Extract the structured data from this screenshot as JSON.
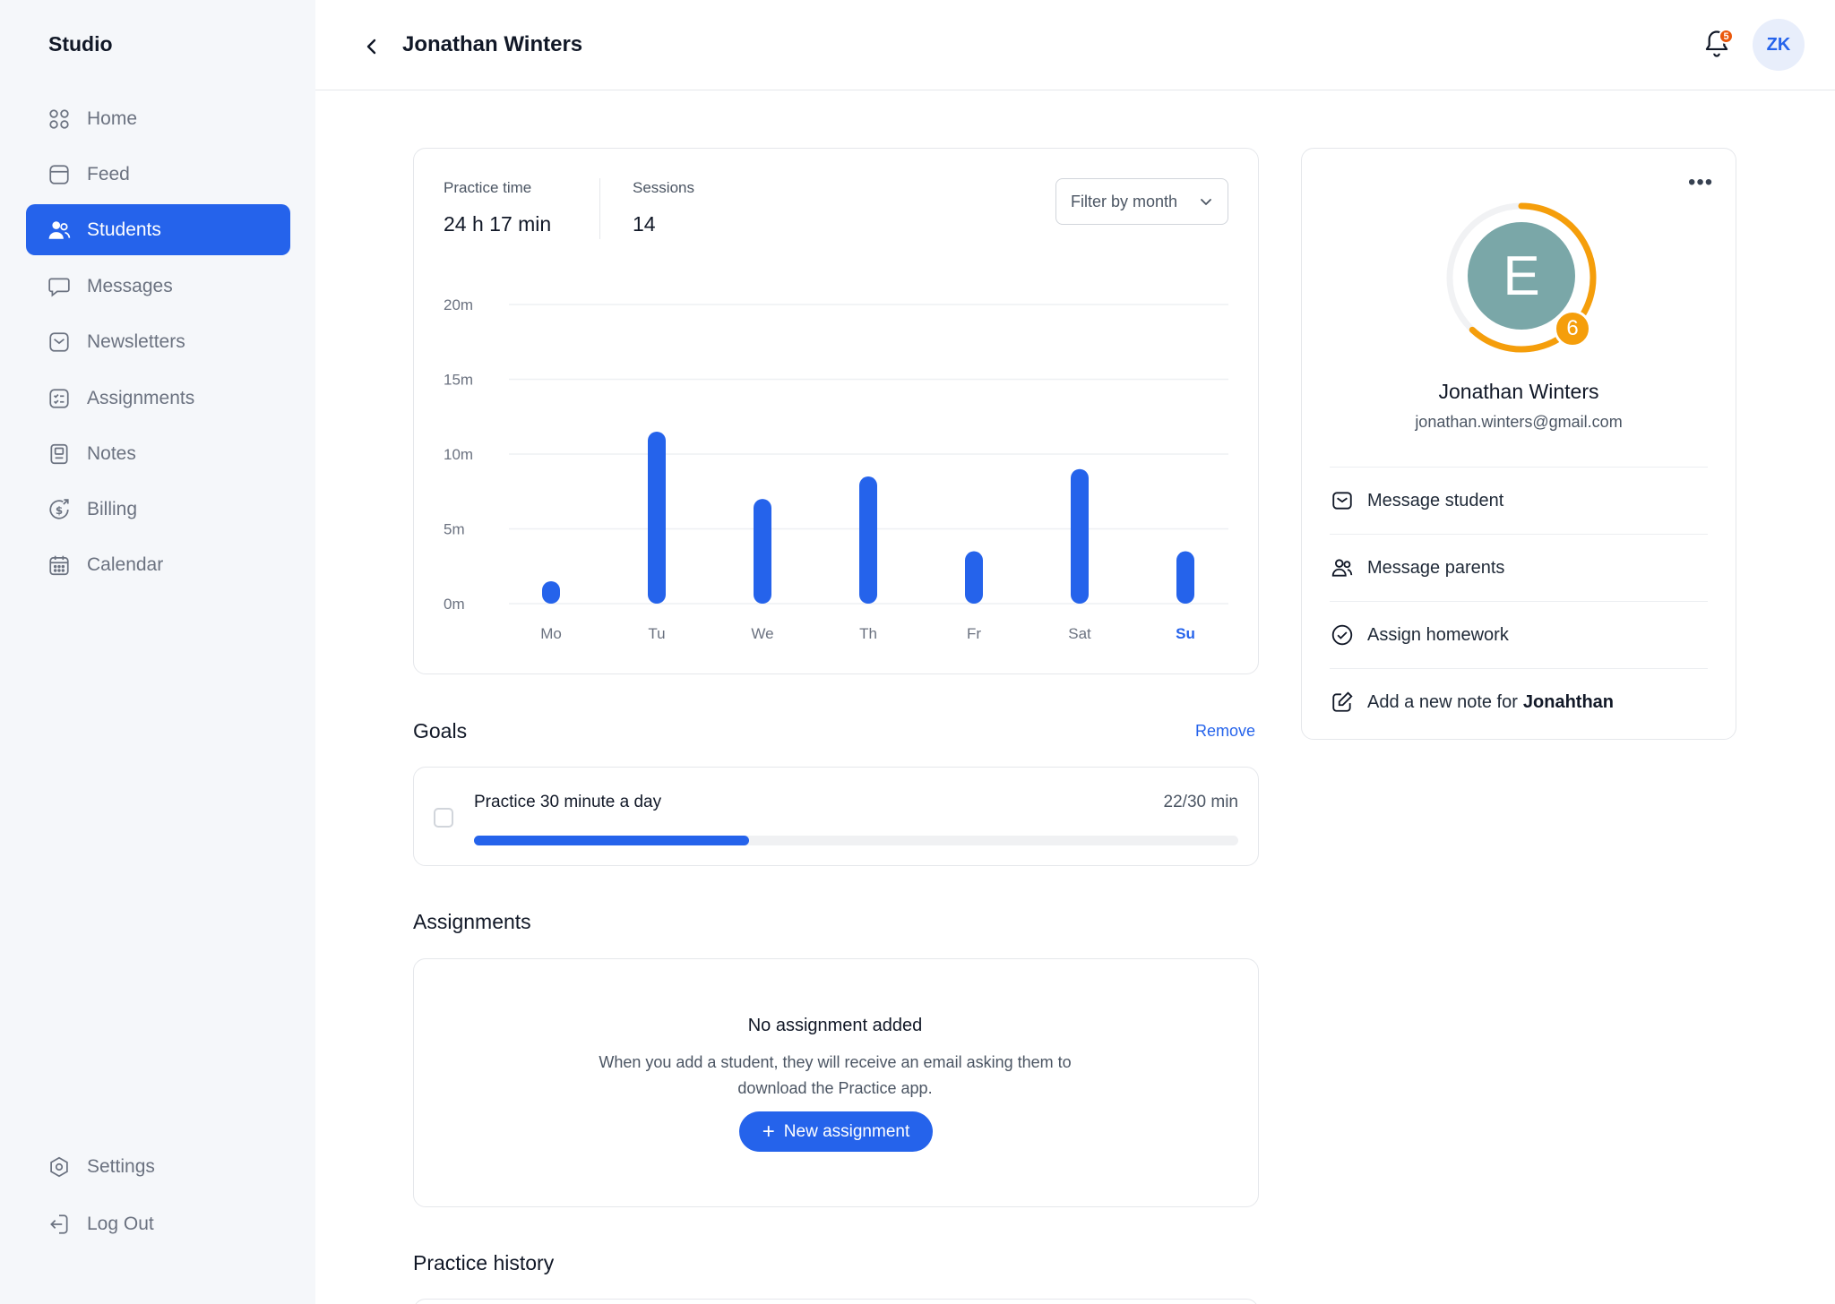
{
  "app": {
    "brand": "Studio"
  },
  "sidebar": {
    "items": [
      {
        "label": "Home",
        "icon": "grid-icon"
      },
      {
        "label": "Feed",
        "icon": "feed-icon"
      },
      {
        "label": "Students",
        "icon": "users-icon",
        "active": true
      },
      {
        "label": "Messages",
        "icon": "message-icon"
      },
      {
        "label": "Newsletters",
        "icon": "mail-icon"
      },
      {
        "label": "Assignments",
        "icon": "checklist-icon"
      },
      {
        "label": "Notes",
        "icon": "notebook-icon"
      },
      {
        "label": "Billing",
        "icon": "billing-icon"
      },
      {
        "label": "Calendar",
        "icon": "calendar-icon"
      }
    ],
    "bottom": [
      {
        "label": "Settings",
        "icon": "settings-icon"
      },
      {
        "label": "Log Out",
        "icon": "logout-icon"
      }
    ]
  },
  "header": {
    "title": "Jonathan Winters",
    "notification_count": "5",
    "user_initials": "ZK"
  },
  "stats": {
    "practice_time_label": "Practice time",
    "practice_time_value": "24 h 17 min",
    "sessions_label": "Sessions",
    "sessions_value": "14",
    "filter_label": "Filter by month"
  },
  "chart_data": {
    "type": "bar",
    "categories": [
      "Mo",
      "Tu",
      "We",
      "Th",
      "Fr",
      "Sat",
      "Su"
    ],
    "values": [
      1.5,
      11.5,
      7,
      8.5,
      3.5,
      9,
      3.5
    ],
    "y_ticks": [
      "0m",
      "5m",
      "10m",
      "15m",
      "20m"
    ],
    "ylim": [
      0,
      20
    ],
    "highlight_category": "Su",
    "bar_color": "#2563eb",
    "grid": true
  },
  "goals": {
    "title": "Goals",
    "remove_label": "Remove",
    "items": [
      {
        "label": "Practice 30 minute a day",
        "value": "22/30 min",
        "progress": 0.36
      }
    ]
  },
  "assignments": {
    "title": "Assignments",
    "empty_title": "No assignment added",
    "empty_desc": "When you add a student, they will receive an email asking them to download the Practice app.",
    "new_button": "New assignment"
  },
  "practice_history": {
    "title": "Practice history"
  },
  "profile": {
    "initial": "E",
    "level": "6",
    "name": "Jonathan Winters",
    "email": "jonathan.winters@gmail.com",
    "ring_progress": 0.62,
    "ring_color": "#f59e0b",
    "avatar_color": "#7aa7a8",
    "actions": [
      {
        "label": "Message student",
        "icon": "mail-icon"
      },
      {
        "label": "Message parents",
        "icon": "users-icon"
      },
      {
        "label": "Assign homework",
        "icon": "check-circle-icon"
      },
      {
        "label": "Add a new note for",
        "bold": "Jonahthan",
        "icon": "edit-icon"
      }
    ]
  }
}
